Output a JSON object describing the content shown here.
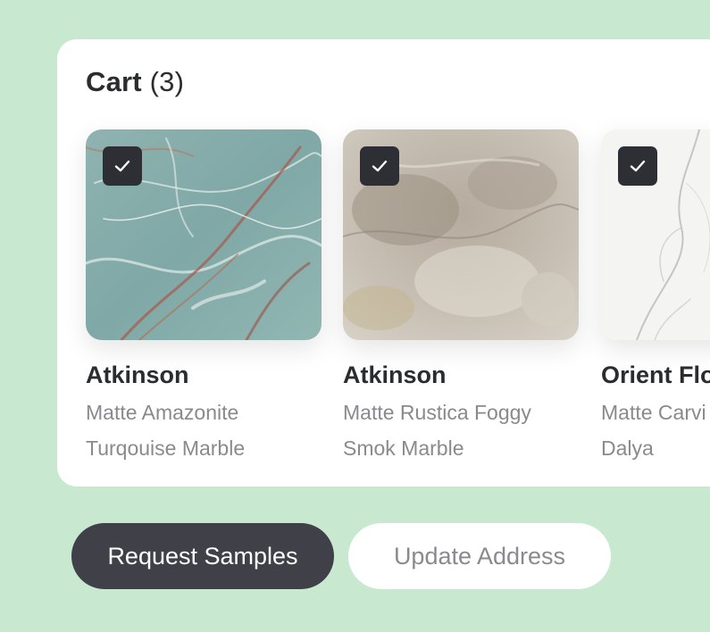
{
  "cart": {
    "title": "Cart",
    "count": "(3)",
    "items": [
      {
        "name": "Atkinson",
        "line1": "Matte Amazonite",
        "line2": "Turqouise Marble",
        "selected": true,
        "swatch": "turquoise-marble"
      },
      {
        "name": "Atkinson",
        "line1": "Matte Rustica Foggy",
        "line2": "Smok Marble",
        "selected": true,
        "swatch": "foggy-smoke-marble"
      },
      {
        "name": "Orient Flo",
        "line1": "Matte Carvi",
        "line2": "Dalya",
        "selected": true,
        "swatch": "white-carrara-marble"
      }
    ]
  },
  "actions": {
    "request_samples": "Request Samples",
    "update_address": "Update Address"
  },
  "colors": {
    "background": "#c9e8d0",
    "card": "#ffffff",
    "primary_button": "#404048",
    "text_dark": "#2b2c30",
    "text_muted": "#8a8a8e",
    "checkbox": "#2e2f35"
  },
  "icons": {
    "checkbox": "check-icon"
  }
}
